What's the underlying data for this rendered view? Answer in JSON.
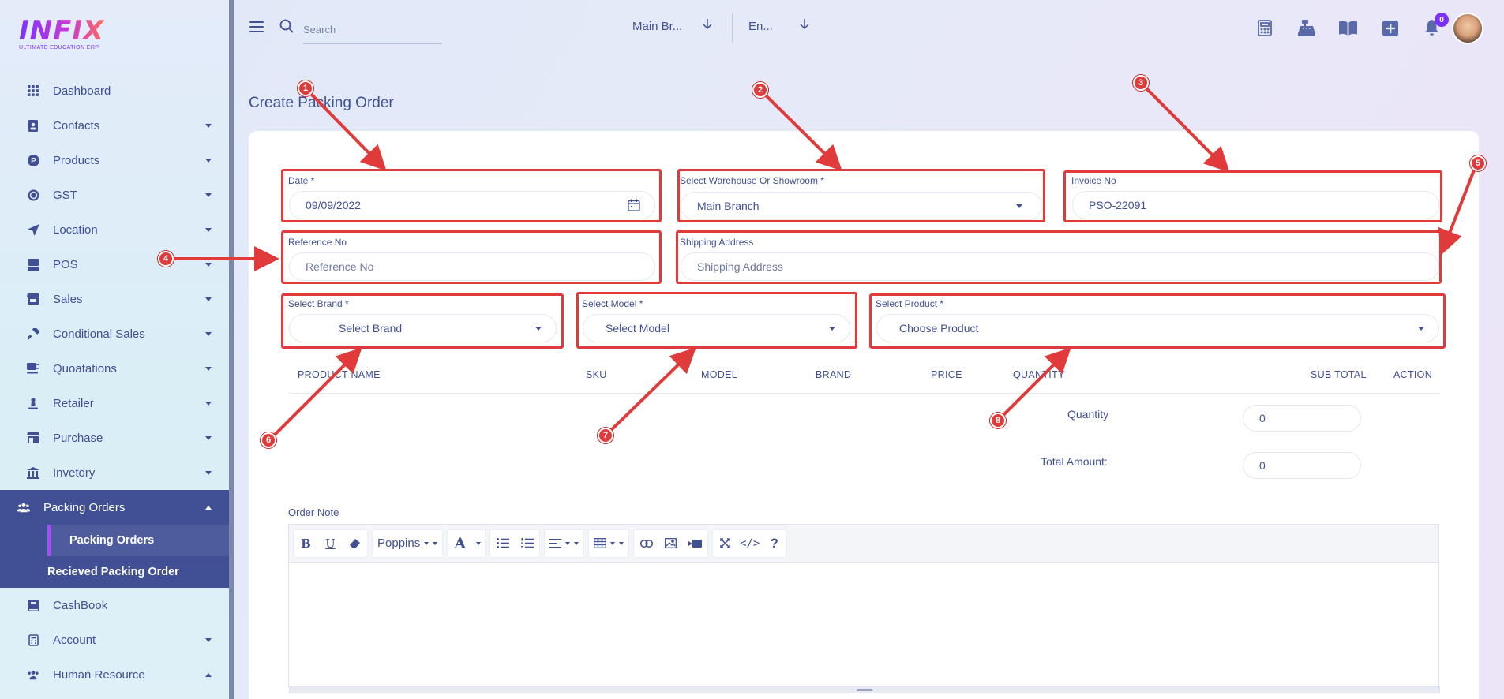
{
  "brand": {
    "logo": "INFIX",
    "tagline": "ULTIMATE EDUCATION ERP"
  },
  "sidebar": {
    "items": [
      {
        "label": "Dashboard",
        "icon": "grid-icon",
        "caret": false
      },
      {
        "label": "Contacts",
        "icon": "contacts-icon",
        "caret": true
      },
      {
        "label": "Products",
        "icon": "product-icon",
        "caret": true
      },
      {
        "label": "GST",
        "icon": "coin-icon",
        "caret": true
      },
      {
        "label": "Location",
        "icon": "location-arrow-icon",
        "caret": true
      },
      {
        "label": "POS",
        "icon": "pos-icon",
        "caret": true
      },
      {
        "label": "Sales",
        "icon": "store-icon",
        "caret": true
      },
      {
        "label": "Conditional Sales",
        "icon": "hammer-icon",
        "caret": true
      },
      {
        "label": "Quoatations",
        "icon": "cup-icon",
        "caret": true
      },
      {
        "label": "Retailer",
        "icon": "person-icon",
        "caret": true
      },
      {
        "label": "Purchase",
        "icon": "shop-icon",
        "caret": true
      },
      {
        "label": "Invetory",
        "icon": "bank-icon",
        "caret": true
      }
    ],
    "active": {
      "label": "Packing Orders",
      "icon": "users-icon"
    },
    "sub_items": [
      "Packing Orders",
      "Recieved Packing Order"
    ],
    "after": [
      {
        "label": "CashBook",
        "icon": "book-icon",
        "caret": false
      },
      {
        "label": "Account",
        "icon": "calculator-icon",
        "caret": true
      },
      {
        "label": "Human Resource",
        "icon": "users-icon",
        "caret": true
      }
    ]
  },
  "header": {
    "search_placeholder": "Search",
    "branch": "Main Br...",
    "language": "En...",
    "notifications": "0",
    "icons": [
      "calculator-icon",
      "cash-register-icon",
      "book-open-icon",
      "plus-square-icon",
      "bell-icon"
    ]
  },
  "page": {
    "title": "Create Packing Order"
  },
  "form": {
    "date": {
      "label": "Date *",
      "value": "09/09/2022"
    },
    "warehouse": {
      "label": "Select Warehouse Or Showroom *",
      "value": "Main Branch"
    },
    "invoice": {
      "label": "Invoice No",
      "value": "PSO-22091"
    },
    "reference": {
      "label": "Reference No",
      "placeholder": "Reference No"
    },
    "shipping": {
      "label": "Shipping Address",
      "placeholder": "Shipping Address"
    },
    "brand": {
      "label": "Select Brand *",
      "placeholder": "Select Brand"
    },
    "model": {
      "label": "Select Model *",
      "placeholder": "Select Model"
    },
    "product": {
      "label": "Select Product *",
      "placeholder": "Choose Product"
    }
  },
  "table": {
    "columns": [
      "PRODUCT NAME",
      "SKU",
      "MODEL",
      "BRAND",
      "PRICE",
      "QUANTITY",
      "SUB TOTAL",
      "ACTION"
    ]
  },
  "summary": {
    "quantity_label": "Quantity",
    "quantity_value": "0",
    "total_label": "Total Amount:",
    "total_value": "0"
  },
  "note": {
    "label": "Order Note",
    "font_name": "Poppins"
  },
  "callouts": [
    "1",
    "2",
    "3",
    "4",
    "5",
    "6",
    "7",
    "8"
  ],
  "colors": {
    "primary": "#415094",
    "accent": "#7c32ff",
    "annotation": "#e03a3a"
  }
}
